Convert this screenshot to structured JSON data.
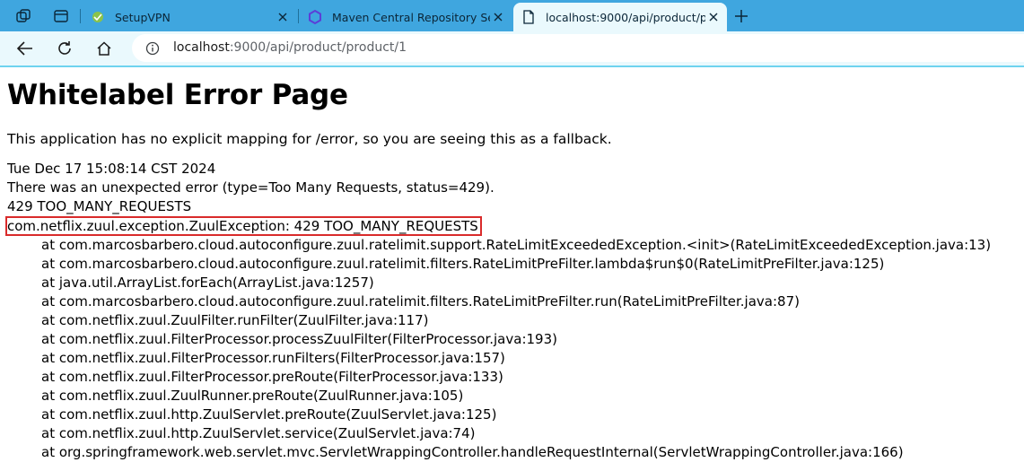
{
  "browser": {
    "tabs": [
      {
        "title": "SetupVPN",
        "icon": "setupvpn-icon"
      },
      {
        "title": "Maven Central Repository Search",
        "icon": "maven-icon"
      },
      {
        "title": "localhost:9000/api/product/produ",
        "icon": "page-icon"
      }
    ],
    "address": {
      "host": "localhost",
      "path": ":9000/api/product/product/1"
    },
    "accent_color": "#3fa6df"
  },
  "page": {
    "title": "Whitelabel Error Page",
    "message": "This application has no explicit mapping for /error, so you are seeing this as a fallback.",
    "timestamp": "Tue Dec 17 15:08:14 CST 2024",
    "error_summary": "There was an unexpected error (type=Too Many Requests, status=429).",
    "status_line": "429 TOO_MANY_REQUESTS",
    "exception": "com.netflix.zuul.exception.ZuulException: 429 TOO_MANY_REQUESTS",
    "stack_trace": [
      "at com.marcosbarbero.cloud.autoconfigure.zuul.ratelimit.support.RateLimitExceededException.<init>(RateLimitExceededException.java:13)",
      "at com.marcosbarbero.cloud.autoconfigure.zuul.ratelimit.filters.RateLimitPreFilter.lambda$run$0(RateLimitPreFilter.java:125)",
      "at java.util.ArrayList.forEach(ArrayList.java:1257)",
      "at com.marcosbarbero.cloud.autoconfigure.zuul.ratelimit.filters.RateLimitPreFilter.run(RateLimitPreFilter.java:87)",
      "at com.netflix.zuul.ZuulFilter.runFilter(ZuulFilter.java:117)",
      "at com.netflix.zuul.FilterProcessor.processZuulFilter(FilterProcessor.java:193)",
      "at com.netflix.zuul.FilterProcessor.runFilters(FilterProcessor.java:157)",
      "at com.netflix.zuul.FilterProcessor.preRoute(FilterProcessor.java:133)",
      "at com.netflix.zuul.ZuulRunner.preRoute(ZuulRunner.java:105)",
      "at com.netflix.zuul.http.ZuulServlet.preRoute(ZuulServlet.java:125)",
      "at com.netflix.zuul.http.ZuulServlet.service(ZuulServlet.java:74)",
      "at org.springframework.web.servlet.mvc.ServletWrappingController.handleRequestInternal(ServletWrappingController.java:166)"
    ],
    "highlight_color": "#d92b2b"
  }
}
